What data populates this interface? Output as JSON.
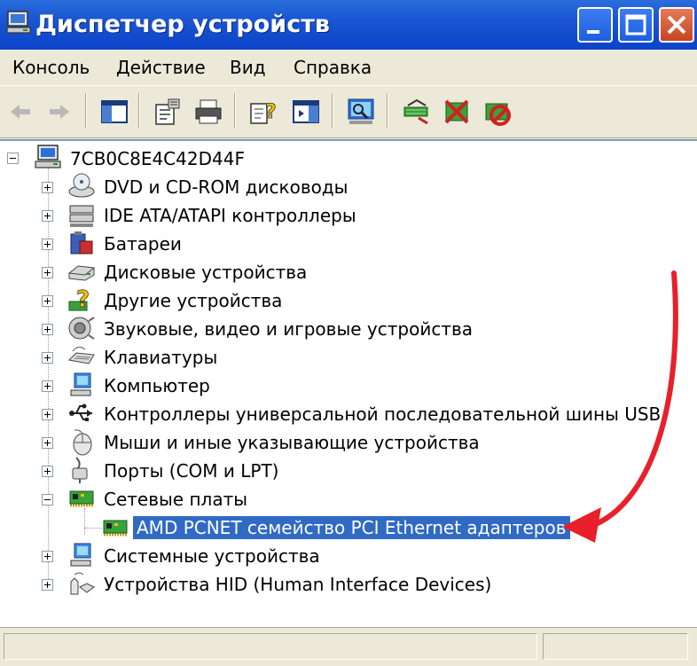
{
  "window": {
    "title": "Диспетчер устройств"
  },
  "menu": [
    "Консоль",
    "Действие",
    "Вид",
    "Справка"
  ],
  "toolbar": {
    "buttons": [
      "back-icon",
      "forward-icon",
      "show-hide-tree-icon",
      "properties-icon",
      "print-icon",
      "help-icon",
      "show-console-icon",
      "scan-hardware-icon",
      "update-driver-icon",
      "uninstall-icon",
      "disable-icon"
    ]
  },
  "tree": {
    "root": "7CB0C8E4C42D44F",
    "categories": [
      {
        "label": "DVD и CD-ROM дисководы",
        "icon": "dvd-icon",
        "expanded": false
      },
      {
        "label": "IDE ATA/ATAPI контроллеры",
        "icon": "ide-controller-icon",
        "expanded": false
      },
      {
        "label": "Батареи",
        "icon": "battery-icon",
        "expanded": false
      },
      {
        "label": "Дисковые устройства",
        "icon": "disk-drive-icon",
        "expanded": false
      },
      {
        "label": "Другие устройства",
        "icon": "unknown-device-icon",
        "expanded": false
      },
      {
        "label": "Звуковые, видео и игровые устройства",
        "icon": "sound-icon",
        "expanded": false
      },
      {
        "label": "Клавиатуры",
        "icon": "keyboard-icon",
        "expanded": false
      },
      {
        "label": "Компьютер",
        "icon": "computer-icon",
        "expanded": false
      },
      {
        "label": "Контроллеры универсальной последовательной шины USB",
        "icon": "usb-icon",
        "expanded": false
      },
      {
        "label": "Мыши и иные указывающие устройства",
        "icon": "mouse-icon",
        "expanded": false
      },
      {
        "label": "Порты (COM и LPT)",
        "icon": "port-icon",
        "expanded": false
      },
      {
        "label": "Сетевые платы",
        "icon": "network-card-icon",
        "expanded": true
      },
      {
        "label": "Системные устройства",
        "icon": "system-device-icon",
        "expanded": false
      },
      {
        "label": "Устройства HID (Human Interface Devices)",
        "icon": "hid-icon",
        "expanded": false
      }
    ],
    "network_child": "AMD PCNET семейство PCI Ethernet адаптеров"
  },
  "colors": {
    "titlebar": "#0b44c9",
    "selection": "#316ac5",
    "annotation_arrow": "#e8202a"
  }
}
